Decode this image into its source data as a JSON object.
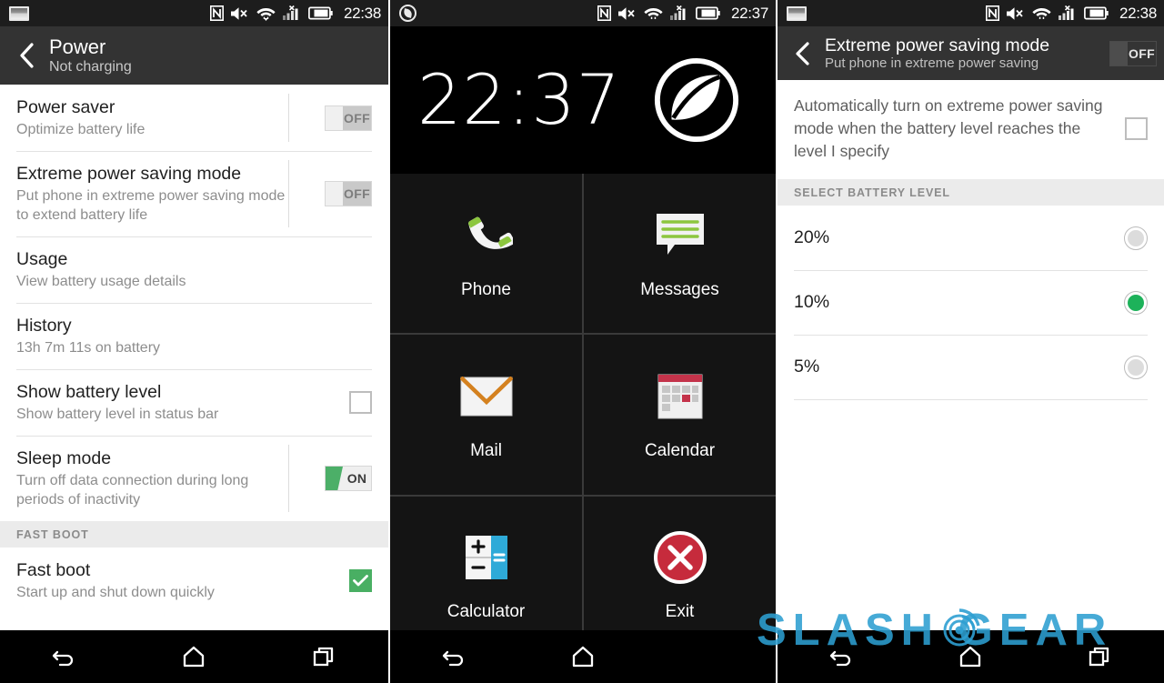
{
  "panel1": {
    "statusbar": {
      "time": "22:38",
      "icons": [
        "screenshot-icon",
        "nfc-icon",
        "mute-icon",
        "wifi-icon",
        "signal-off-icon",
        "battery-icon"
      ]
    },
    "actionbar": {
      "title": "Power",
      "subtitle": "Not charging",
      "back": "back-chevron"
    },
    "rows": [
      {
        "title": "Power saver",
        "subtitle": "Optimize battery life",
        "control": "toggle",
        "state": "OFF"
      },
      {
        "title": "Extreme power saving mode",
        "subtitle": "Put phone in extreme power saving mode to extend battery life",
        "control": "toggle",
        "state": "OFF"
      },
      {
        "title": "Usage",
        "subtitle": "View battery usage details",
        "control": "none",
        "state": ""
      },
      {
        "title": "History",
        "subtitle": "13h 7m 11s on battery",
        "control": "none",
        "state": ""
      },
      {
        "title": "Show battery level",
        "subtitle": "Show battery level in status bar",
        "control": "checkbox",
        "state": "unchecked"
      },
      {
        "title": "Sleep mode",
        "subtitle": "Turn off data connection during long periods of inactivity",
        "control": "toggle",
        "state": "ON"
      }
    ],
    "section": "FAST BOOT",
    "rows2": [
      {
        "title": "Fast boot",
        "subtitle": "Start up and shut down quickly",
        "control": "checkbox",
        "state": "checked"
      }
    ],
    "nav": [
      "back-nav-icon",
      "home-nav-icon",
      "recents-nav-icon"
    ]
  },
  "panel2": {
    "statusbar": {
      "time": "22:37",
      "icons": [
        "leaf-badge-icon",
        "nfc-icon",
        "mute-icon",
        "wifi-icon",
        "signal-off-icon",
        "battery-icon"
      ]
    },
    "clock": "22:37",
    "logo": "leaf-logo-icon",
    "apps": [
      {
        "label": "Phone",
        "icon": "phone-icon"
      },
      {
        "label": "Messages",
        "icon": "messages-icon"
      },
      {
        "label": "Mail",
        "icon": "mail-icon"
      },
      {
        "label": "Calendar",
        "icon": "calendar-icon"
      },
      {
        "label": "Calculator",
        "icon": "calculator-icon"
      },
      {
        "label": "Exit",
        "icon": "exit-icon"
      }
    ],
    "nav": [
      "back-nav-icon",
      "home-nav-icon"
    ]
  },
  "panel3": {
    "statusbar": {
      "time": "22:38",
      "icons": [
        "screenshot-icon",
        "nfc-icon",
        "mute-icon",
        "wifi-icon",
        "signal-icon",
        "battery-icon"
      ]
    },
    "actionbar": {
      "title": "Extreme power saving mode",
      "subtitle": "Put phone in extreme power saving",
      "toggle_state": "OFF",
      "back": "back-chevron"
    },
    "auto_option": {
      "text": "Automatically turn on extreme power saving mode when the battery level reaches the level I specify",
      "checked": false
    },
    "section": "SELECT BATTERY LEVEL",
    "levels": [
      {
        "label": "20%",
        "selected": false
      },
      {
        "label": "10%",
        "selected": true
      },
      {
        "label": "5%",
        "selected": false
      }
    ],
    "nav": [
      "back-nav-icon",
      "home-nav-icon",
      "recents-nav-icon"
    ]
  },
  "watermark": {
    "text": "SLASH    GEAR",
    "color": "#2d9fd1"
  },
  "colors": {
    "accent_green": "#49af63",
    "toggle_on": "#4caf68",
    "radio_selected": "#1db25a",
    "actionbar": "#333333",
    "statusbar": "#1d1d1d"
  }
}
